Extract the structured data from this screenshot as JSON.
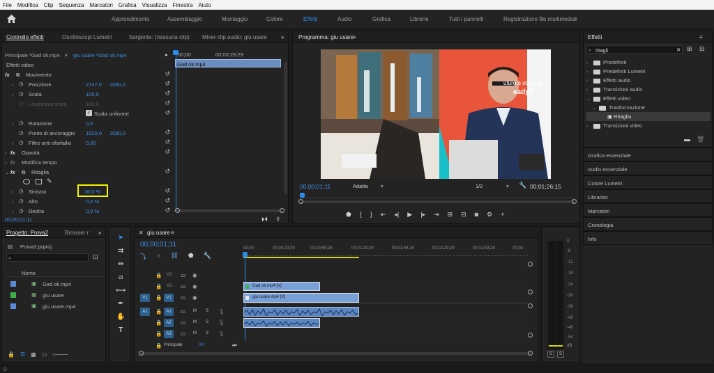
{
  "menu": [
    "File",
    "Modifica",
    "Clip",
    "Sequenza",
    "Marcatori",
    "Grafica",
    "Visualizza",
    "Finestra",
    "Aiuto"
  ],
  "workspaces": {
    "home_icon": "home-icon",
    "tabs": [
      "Apprendimento",
      "Assemblaggio",
      "Montaggio",
      "Colore",
      "Effetti",
      "Audio",
      "Grafica",
      "Librerie",
      "Tutti i pannelli",
      "Registrazione file multimediali"
    ],
    "active": "Effetti"
  },
  "effect_controls": {
    "tabs": [
      "Controllo effetti",
      "Oscilloscopi Lumetri",
      "Sorgente: (nessuna clip)",
      "Mixer clip audio: giu usare"
    ],
    "expand": "»",
    "source": "Principale *Gad ok.mp4",
    "sequence": "giu usare *Gad ok.mp4",
    "ruler": [
      "00;00",
      "00;00;29;29"
    ],
    "clip_name": "Gad ok.mp4",
    "section": "Effetti video",
    "movimento": "Movimento",
    "posizione_label": "Posizione",
    "posizione_x": "2747,0",
    "posizione_y": "1080,0",
    "scala_label": "Scala",
    "scala_value": "100,0",
    "larghezza_label": "Larghezza scala",
    "larghezza_value": "100,0",
    "scala_uniforme": "Scala uniforme",
    "rotazione_label": "Rotazione",
    "rotazione_value": "0,0",
    "ancoraggio_label": "Punto di ancoraggio",
    "ancoraggio_x": "1920,0",
    "ancoraggio_y": "1080,0",
    "filtro_label": "Filtro anti-sfarfallio",
    "filtro_value": "0,00",
    "opacita": "Opacità",
    "modifica_tempo": "Modifica tempo",
    "ritaglia": "Ritaglia",
    "sinistra_label": "Sinistra",
    "sinistra_value": "30,0 %",
    "alto_label": "Alto",
    "alto_value": "0,0 %",
    "destra_label": "Destra",
    "destra_value": "0,0 %",
    "timecode": "00;00;01;11"
  },
  "program": {
    "title": "Programma: giu usare",
    "timecode": "00;00;01;11",
    "fit": "Adatta",
    "resolution": "1/2",
    "duration": "00;01;26;15",
    "video_text_1": "uturo è straordi",
    "video_text_2": "eady?"
  },
  "effects_panel": {
    "title": "Effetti",
    "search_value": "ritagli",
    "tree": [
      "Predefiniti",
      "Predefiniti Lumetri",
      "Effetti audio",
      "Transizioni audio",
      "Effetti video",
      "Trasformazione",
      "Ritaglia",
      "Transizioni video"
    ],
    "other_panels": [
      "Grafica essenziale",
      "Audio essenziale",
      "Colore Lumetri",
      "Libraries",
      "Marcatori",
      "Cronologia",
      "Info"
    ]
  },
  "project": {
    "tabs": [
      "Progetto: Prova2",
      "Browser r"
    ],
    "expand": "»",
    "file": "Prova2.prproj",
    "column": "Nome",
    "items": [
      {
        "name": "Gad ok.mp4",
        "color": "#5b8bd6"
      },
      {
        "name": "giu usare",
        "color": "#3fb04a"
      },
      {
        "name": "giu usare.mp4",
        "color": "#5b8bd6"
      }
    ]
  },
  "timeline": {
    "title": "giu usare",
    "timecode": "00;00;01;11",
    "ruler": [
      "00;00",
      "00;00;29;29",
      "00;00;59;28",
      "00;01;29;29",
      "00;01;59;28",
      "00;02;29;29",
      "00;02;59;28",
      "00;03"
    ],
    "video_tracks": [
      "V3",
      "V2",
      "V1"
    ],
    "audio_tracks": [
      "A1",
      "A2",
      "A3"
    ],
    "source_v": "V1",
    "source_a": "A1",
    "principale": "Principale",
    "principale_value": "0,0",
    "clip_v2": "Gad ok.mp4 [V]",
    "clip_v1": "giu usare.mp4 [V]",
    "m": "M",
    "s": "S"
  },
  "meter": {
    "scale": [
      "0",
      "-6",
      "-12",
      "-18",
      "-24",
      "-30",
      "-36",
      "-42",
      "-48",
      "-54",
      "dB"
    ],
    "solo": "S"
  },
  "colors": {
    "accent": "#2d8ceb",
    "highlight": "#f5f500",
    "panel": "#232323"
  }
}
